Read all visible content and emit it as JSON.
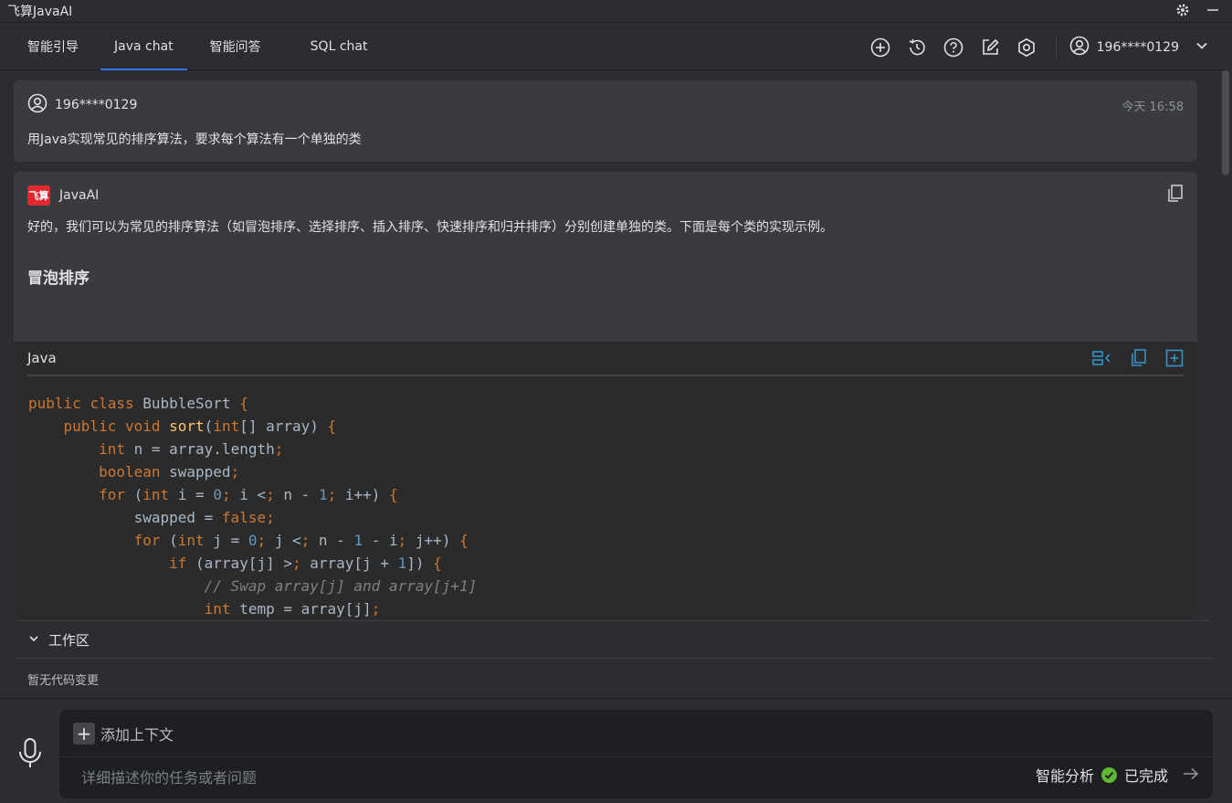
{
  "window": {
    "title": "飞算JavaAI"
  },
  "tabs": [
    {
      "label": "智能引导",
      "active": false
    },
    {
      "label": "Java chat",
      "active": true
    },
    {
      "label": "智能问答",
      "active": false
    },
    {
      "label": "SQL chat",
      "active": false
    }
  ],
  "nav_icons": [
    "plus-circle-icon",
    "history-icon",
    "help-icon",
    "edit-icon",
    "settings-hex-icon"
  ],
  "user": {
    "name": "196****0129"
  },
  "user_message": {
    "user": "196****0129",
    "time": "今天 16:58",
    "text": "用Java实现常见的排序算法，要求每个算法有一个单独的类"
  },
  "ai_message": {
    "name": "JavaAI",
    "logo_text": "飞算",
    "intro": "好的，我们可以为常见的排序算法（如冒泡排序、选择排序、插入排序、快速排序和归并排序）分别创建单独的类。下面是每个类的实现示例。",
    "heading": "冒泡排序",
    "code_lang": "Java",
    "code_lines": [
      "public class BubbleSort {",
      "    public void sort(int[] array) {",
      "        int n = array.length;",
      "        boolean swapped;",
      "        for (int i = 0; i < n - 1; i++) {",
      "            swapped = false;",
      "            for (int j = 0; j < n - 1 - i; j++) {",
      "                if (array[j] > array[j + 1]) {",
      "                    // Swap array[j] and array[j+1]",
      "                    int temp = array[j];"
    ]
  },
  "workspace": {
    "title": "工作区",
    "empty_text": "暂无代码变更"
  },
  "input": {
    "add_context": "添加上下文",
    "placeholder": "详细描述你的任务或者问题",
    "mode": "智能分析",
    "status": "已完成"
  },
  "colors": {
    "accent": "#3574f0",
    "brand_red": "#e0282e",
    "success": "#5fb832",
    "keyword": "#cc7832",
    "number": "#6897bb",
    "function": "#ffc66d"
  }
}
